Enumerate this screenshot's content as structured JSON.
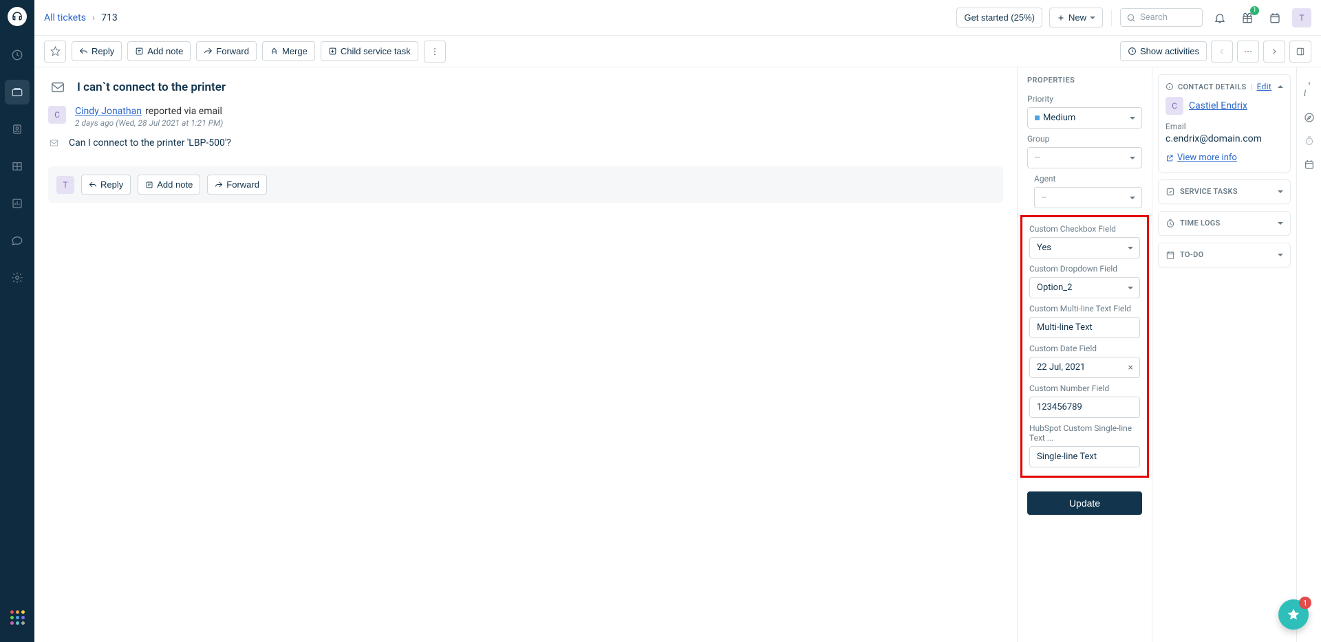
{
  "breadcrumb": {
    "root": "All tickets",
    "current": "713"
  },
  "topbar": {
    "get_started": "Get started (25%)",
    "new": "New",
    "search_placeholder": "Search",
    "gift_badge": "1",
    "avatar_initial": "T"
  },
  "toolbar": {
    "reply": "Reply",
    "add_note": "Add note",
    "forward": "Forward",
    "merge": "Merge",
    "child_task": "Child service task",
    "show_activities": "Show activities"
  },
  "ticket": {
    "title": "I can`t connect to the printer",
    "reporter_name": "Cindy Jonathan",
    "reporter_via": "reported via email",
    "timestamp": "2 days ago (Wed, 28 Jul 2021 at 1:21 PM)",
    "reporter_initial": "C",
    "body": "Can I connect to the printer 'LBP-500'?"
  },
  "reply_card": {
    "initial": "T",
    "reply": "Reply",
    "add_note": "Add note",
    "forward": "Forward"
  },
  "properties": {
    "header": "PROPERTIES",
    "priority_label": "Priority",
    "priority_value": "Medium",
    "group_label": "Group",
    "group_value": "--",
    "agent_label": "Agent",
    "agent_value": "--",
    "custom_checkbox_label": "Custom Checkbox Field",
    "custom_checkbox_value": "Yes",
    "custom_dropdown_label": "Custom Dropdown Field",
    "custom_dropdown_value": "Option_2",
    "custom_multiline_label": "Custom Multi-line Text Field",
    "custom_multiline_value": "Multi-line Text",
    "custom_date_label": "Custom Date Field",
    "custom_date_value": "22 Jul, 2021",
    "custom_number_label": "Custom Number Field",
    "custom_number_value": "123456789",
    "custom_singleline_label": "HubSpot Custom Single-line Text ...",
    "custom_singleline_value": "Single-line Text",
    "update": "Update"
  },
  "contact": {
    "header": "CONTACT DETAILS",
    "edit": "Edit",
    "name": "Castiel Endrix",
    "initial": "C",
    "email_label": "Email",
    "email_value": "c.endrix@domain.com",
    "view_more": "View more info"
  },
  "sections": {
    "service_tasks": "SERVICE TASKS",
    "time_logs": "TIME LOGS",
    "todo": "TO-DO"
  },
  "fab_badge": "1"
}
